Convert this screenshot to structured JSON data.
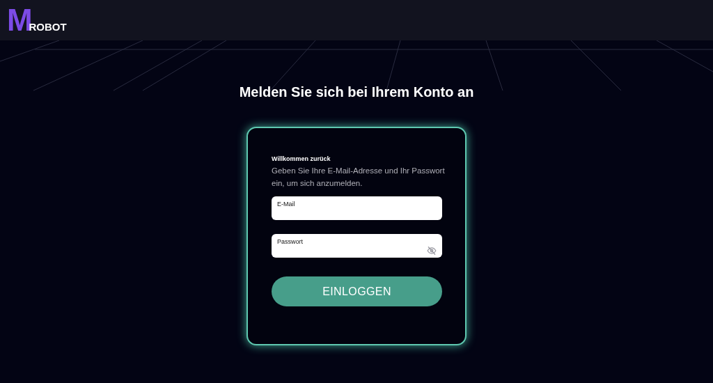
{
  "header": {
    "logo_letter": "M",
    "logo_text": "ROBOT"
  },
  "page_title": "Melden Sie sich bei Ihrem Konto an",
  "login_card": {
    "greeting": "Willkommen zurück",
    "instructions": "Geben Sie Ihre E-Mail-Adresse und Ihr Passwort ein, um sich anzumelden.",
    "fields": [
      {
        "label": "E-Mail",
        "kind": "text"
      },
      {
        "label": "Passwort",
        "kind": "password"
      }
    ],
    "submit_button": "EINLOGGEN"
  }
}
